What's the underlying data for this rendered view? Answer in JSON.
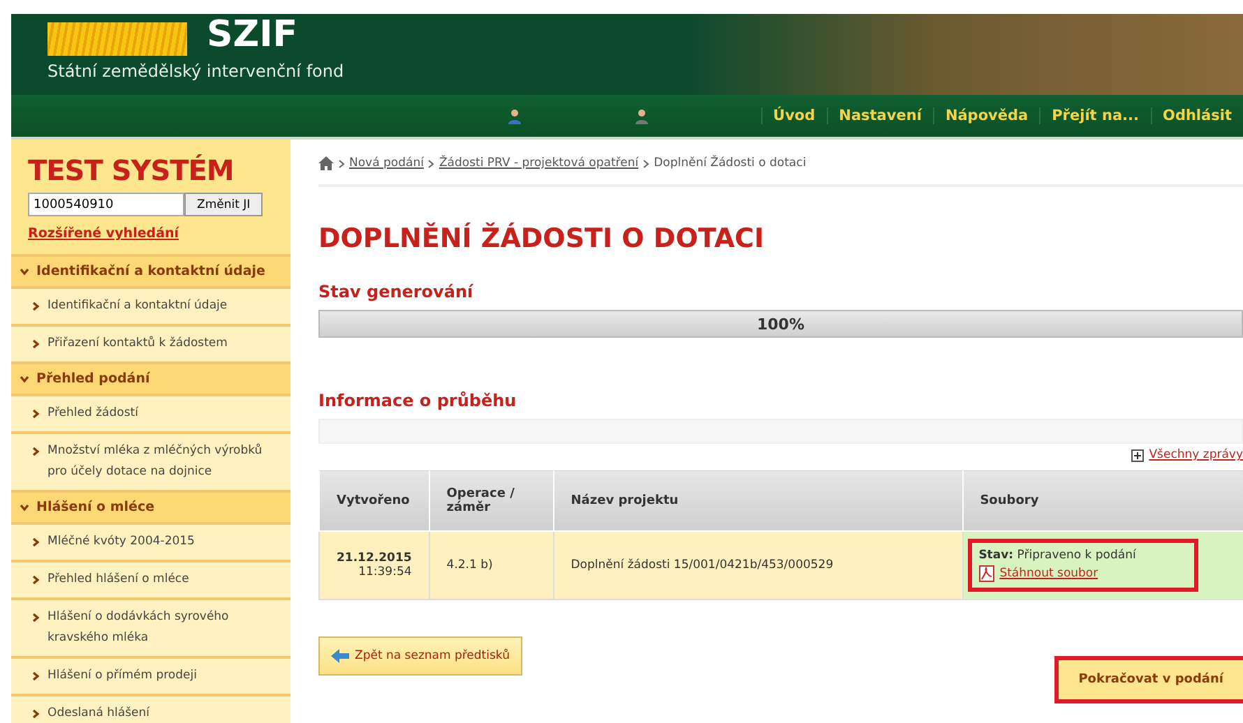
{
  "header": {
    "logo": "SZIF",
    "subtitle": "Státní zemědělský intervenční fond"
  },
  "nav": {
    "items": [
      {
        "label": "Úvod"
      },
      {
        "label": "Nastavení"
      },
      {
        "label": "Nápověda"
      },
      {
        "label": "Přejít na..."
      },
      {
        "label": "Odhlásit"
      }
    ]
  },
  "sidebar": {
    "title": "TEST SYSTÉM",
    "id_field": {
      "value": "1000540910"
    },
    "change_button": "Změnit JI",
    "advanced_search": "Rozšířené vyhledání",
    "sections": [
      {
        "label": "Identifikační a kontaktní údaje",
        "expanded": true,
        "children": [
          {
            "label": "Identifikační a kontaktní údaje"
          },
          {
            "label": "Přiřazení kontaktů k žádostem"
          }
        ]
      },
      {
        "label": "Přehled podání",
        "expanded": true,
        "children": [
          {
            "label": "Přehled žádostí"
          },
          {
            "label": "Množství mléka z mléčných výrobků pro účely dotace na dojnice"
          }
        ]
      },
      {
        "label": "Hlášení o mléce",
        "expanded": true,
        "children": [
          {
            "label": "Mléčné kvóty 2004-2015"
          },
          {
            "label": "Přehled hlášení o mléce"
          },
          {
            "label": "Hlášení o dodávkách syrového kravského mléka"
          },
          {
            "label": "Hlášení o přímém prodeji"
          },
          {
            "label": "Odeslaná hlášení"
          }
        ]
      }
    ]
  },
  "breadcrumb": [
    {
      "label": "Nová podání",
      "kind": "link"
    },
    {
      "label": "Žádosti PRV - projektová opatření",
      "kind": "link"
    },
    {
      "label": "Doplnění Žádosti o dotaci",
      "kind": "current"
    }
  ],
  "page_title": "DOPLNĚNÍ ŽÁDOSTI O DOTACI",
  "generation": {
    "heading": "Stav generování",
    "level": 1,
    "reading": "100%"
  },
  "progress_info": {
    "heading": "Informace o průběhu",
    "all_messages_link": "Všechny zprávy",
    "table": {
      "columns": [
        "Vytvořeno",
        "Operace / záměr",
        "Název projektu",
        "Soubory"
      ],
      "rows": [
        {
          "date": "21.12.2015",
          "time": "11:39:54",
          "operation": "4.2.1 b)",
          "project": "Doplnění žádosti 15/001/0421b/453/000529",
          "status_label": "Stav:",
          "status": "Připraveno k podání",
          "download": "Stáhnout soubor",
          "highlighted": true
        }
      ]
    }
  },
  "back_button": "Zpět na seznam předtisků",
  "continue_button": {
    "label": "Pokračovat v podání",
    "highlighted": true
  }
}
